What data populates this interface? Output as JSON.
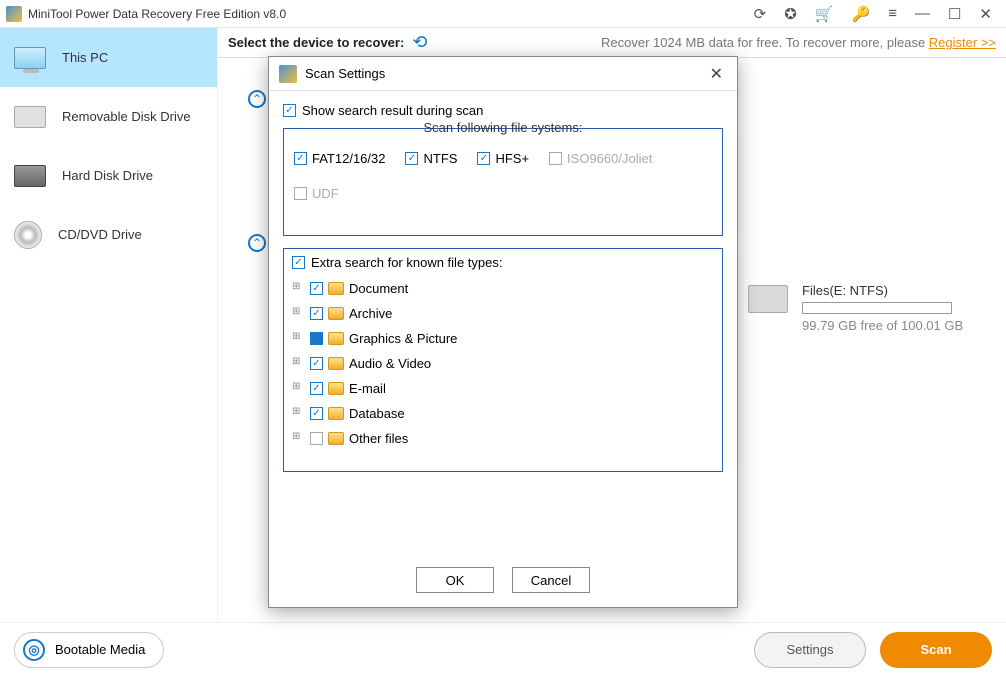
{
  "title": "MiniTool Power Data Recovery Free Edition v8.0",
  "sidebar": {
    "items": [
      {
        "label": "This PC"
      },
      {
        "label": "Removable Disk Drive"
      },
      {
        "label": "Hard Disk Drive"
      },
      {
        "label": "CD/DVD Drive"
      }
    ]
  },
  "topbar": {
    "select_label": "Select the device to recover:",
    "promo": "Recover 1024 MB data for free. To recover more, please ",
    "register": "Register >>"
  },
  "drive": {
    "name": "Files(E: NTFS)",
    "free": "99.79 GB free of 100.01 GB"
  },
  "footer": {
    "bootable": "Bootable Media",
    "settings": "Settings",
    "scan": "Scan"
  },
  "dialog": {
    "title": "Scan Settings",
    "show_result": "Show search result during scan",
    "fs_legend": "Scan following file systems:",
    "fs": {
      "fat": "FAT12/16/32",
      "ntfs": "NTFS",
      "hfs": "HFS+",
      "iso": "ISO9660/Joliet",
      "udf": "UDF"
    },
    "extra": "Extra search for known file types:",
    "types": [
      {
        "label": "Document",
        "state": "checked"
      },
      {
        "label": "Archive",
        "state": "checked"
      },
      {
        "label": "Graphics & Picture",
        "state": "square"
      },
      {
        "label": "Audio & Video",
        "state": "checked"
      },
      {
        "label": "E-mail",
        "state": "checked"
      },
      {
        "label": "Database",
        "state": "checked"
      },
      {
        "label": "Other files",
        "state": "unchecked"
      }
    ],
    "ok": "OK",
    "cancel": "Cancel"
  }
}
